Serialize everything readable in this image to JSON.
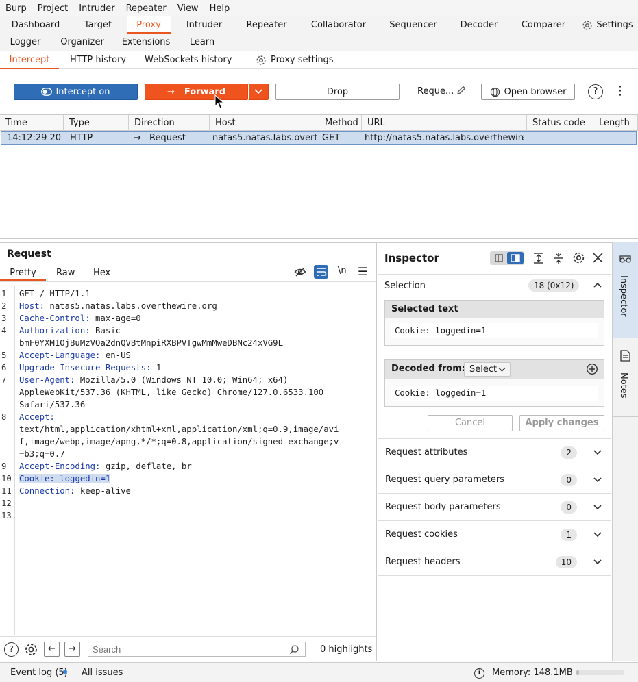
{
  "menubar": [
    "Burp",
    "Project",
    "Intruder",
    "Repeater",
    "View",
    "Help"
  ],
  "main_tabs_row1": [
    "Dashboard",
    "Target",
    "Proxy",
    "Intruder",
    "Repeater",
    "Collaborator",
    "Sequencer",
    "Decoder",
    "Comparer",
    "Settings"
  ],
  "main_tabs_row2": [
    "Logger",
    "Organizer",
    "Extensions",
    "Learn"
  ],
  "sub_tabs": [
    "Intercept",
    "HTTP history",
    "WebSockets history",
    "Proxy settings"
  ],
  "toolbar": {
    "intercept": "Intercept on",
    "forward": "Forward",
    "drop": "Drop",
    "request_label": "Reque...",
    "open_browser": "Open browser"
  },
  "table": {
    "headers": [
      "Time",
      "Type",
      "Direction",
      "Host",
      "Method",
      "URL",
      "Status code",
      "Length"
    ],
    "row": {
      "time": "14:12:29 20 ...",
      "type": "HTTP",
      "direction": "Request",
      "host": "natas5.natas.labs.overt...",
      "method": "GET",
      "url": "http://natas5.natas.labs.overthewire....",
      "status": "",
      "length": ""
    }
  },
  "request": {
    "title": "Request",
    "tabs": [
      "Pretty",
      "Raw",
      "Hex"
    ],
    "newline_toggle": "\\n",
    "lines": [
      {
        "n": "1",
        "k": "",
        "v": "GET / HTTP/1.1"
      },
      {
        "n": "2",
        "k": "Host:",
        "v": " natas5.natas.labs.overthewire.org"
      },
      {
        "n": "3",
        "k": "Cache-Control:",
        "v": " max-age=0"
      },
      {
        "n": "4",
        "k": "Authorization:",
        "v": " Basic"
      },
      {
        "n": "",
        "k": "",
        "v": "bmF0YXM1OjBuMzVQa2dnQVBtMnpiRXBPVTgwMmMweDBNc24xVG9L"
      },
      {
        "n": "5",
        "k": "Accept-Language:",
        "v": " en-US"
      },
      {
        "n": "6",
        "k": "Upgrade-Insecure-Requests:",
        "v": " 1"
      },
      {
        "n": "7",
        "k": "User-Agent:",
        "v": " Mozilla/5.0 (Windows NT 10.0; Win64; x64)"
      },
      {
        "n": "",
        "k": "",
        "v": "AppleWebKit/537.36 (KHTML, like Gecko) Chrome/127.0.6533.100"
      },
      {
        "n": "",
        "k": "",
        "v": "Safari/537.36"
      },
      {
        "n": "8",
        "k": "Accept:",
        "v": ""
      },
      {
        "n": "",
        "k": "",
        "v": "text/html,application/xhtml+xml,application/xml;q=0.9,image/avi"
      },
      {
        "n": "",
        "k": "",
        "v": "f,image/webp,image/apng,*/*;q=0.8,application/signed-exchange;v"
      },
      {
        "n": "",
        "k": "",
        "v": "=b3;q=0.7"
      },
      {
        "n": "9",
        "k": "Accept-Encoding:",
        "v": " gzip, deflate, br"
      },
      {
        "n": "10",
        "k": "Cookie:",
        "v": " loggedin=1"
      },
      {
        "n": "11",
        "k": "Connection:",
        "v": " keep-alive"
      },
      {
        "n": "12",
        "k": "",
        "v": ""
      },
      {
        "n": "13",
        "k": "",
        "v": ""
      }
    ],
    "search_placeholder": "Search",
    "highlights": "0 highlights"
  },
  "inspector": {
    "title": "Inspector",
    "selection_label": "Selection",
    "selection_badge": "18 (0x12)",
    "selected_text_label": "Selected text",
    "selected_text": "Cookie: loggedin=1",
    "decoded_from_label": "Decoded from:",
    "decoded_select": "Select",
    "decoded_text": "Cookie: loggedin=1",
    "cancel": "Cancel",
    "apply": "Apply changes",
    "sections": [
      {
        "label": "Request attributes",
        "count": "2"
      },
      {
        "label": "Request query parameters",
        "count": "0"
      },
      {
        "label": "Request body parameters",
        "count": "0"
      },
      {
        "label": "Request cookies",
        "count": "1"
      },
      {
        "label": "Request headers",
        "count": "10"
      }
    ]
  },
  "rail": {
    "inspector": "Inspector",
    "notes": "Notes"
  },
  "statusbar": {
    "event_log": "Event log (5)",
    "all_issues": "All issues",
    "memory": "Memory: 148.1MB"
  },
  "colors": {
    "accent": "#e8571f",
    "intercept": "#2f6db6",
    "forward": "#f0541e",
    "selection": "#cddcef"
  }
}
